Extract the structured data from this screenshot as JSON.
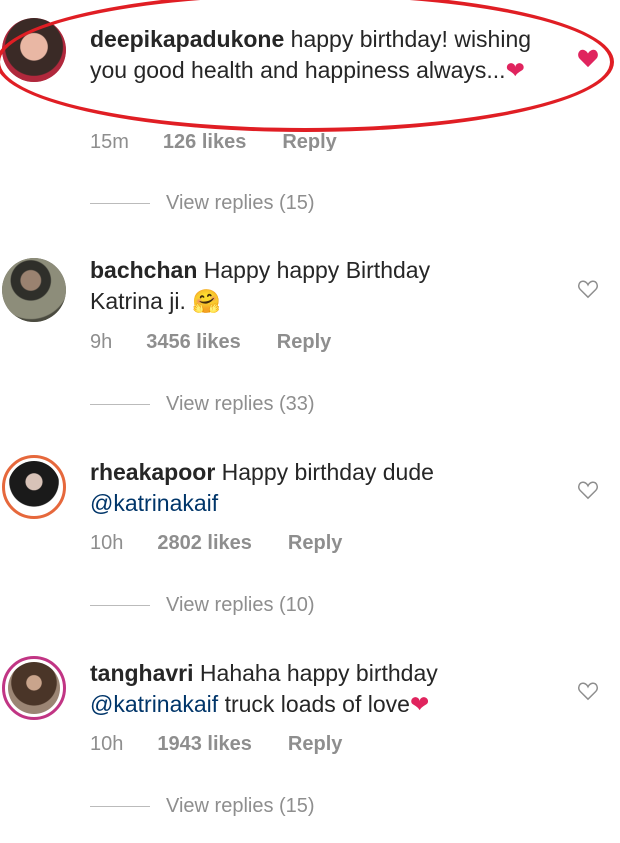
{
  "comments": [
    {
      "username": "deepikapadukone",
      "text": "happy birthday! wishing you good health and happiness always...",
      "emoji": "❤",
      "time": "15m",
      "likes": "126 likes",
      "reply": "Reply",
      "view_replies": "View replies (15)",
      "liked": true
    },
    {
      "username": "bachchan",
      "text": "Happy happy Birthday Katrina  ji.",
      "emoji": "🤗",
      "time": "9h",
      "likes": "3456 likes",
      "reply": "Reply",
      "view_replies": "View replies (33)",
      "liked": false
    },
    {
      "username": "rheakapoor",
      "text": "Happy birthday dude",
      "mention": "@katrinakaif",
      "time": "10h",
      "likes": "2802 likes",
      "reply": "Reply",
      "view_replies": "View replies (10)",
      "liked": false
    },
    {
      "username": "tanghavri",
      "text": "Hahaha happy birthday",
      "mention": "@katrinakaif",
      "text2": "truck loads of love",
      "emoji": "❤",
      "time": "10h",
      "likes": "1943 likes",
      "reply": "Reply",
      "view_replies": "View replies (15)",
      "liked": false
    }
  ],
  "colors": {
    "highlight": "#e01e24",
    "heart_liked": "#e0245e",
    "mention": "#003569",
    "muted": "#8e8e8e"
  }
}
